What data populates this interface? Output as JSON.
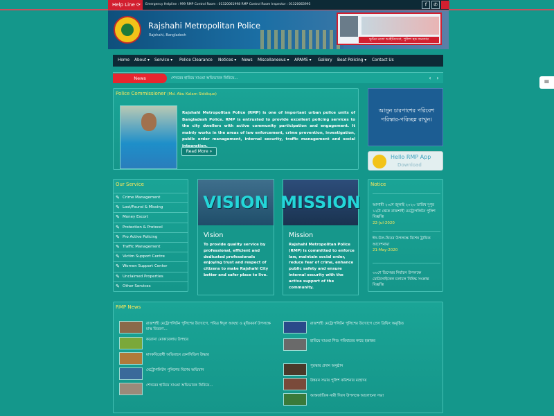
{
  "topbar": {
    "helpline": "Help Line",
    "emergency": "Emergency Helpline : 999     RMP Control Room : 01320061998     RMP Control Room Inspector : 01320063995",
    "social": [
      "f",
      "✆"
    ]
  },
  "header": {
    "title": "Rajshahi Metropolitan Police",
    "subtitle": "Rajshahi, Bangladesh",
    "banner_text": "ভূমির মতো আইনিসেবা, পুলিশ হক জনতার"
  },
  "nav": {
    "items": [
      "Home",
      "About ▾",
      "Service ▾",
      "Police Clearance",
      "Notices ▾",
      "News",
      "Miscellaneous ▾",
      "APAMS ▾",
      "Gallery",
      "Beat Policing ▾",
      "Contact Us"
    ]
  },
  "ticker": {
    "label": "News",
    "text": "শেখরের হারিয়ে যাওয়া অভিভাবক ফিরিয়ে...",
    "prev": "‹",
    "next": "›"
  },
  "commissioner": {
    "heading": "Police Commissioner",
    "name": "(Md. Abu Kalam Siddique)",
    "description": "Rajshahi Metropolitan Police (RMP) is one of important urban police units of Bangladesh Police. RMP is entrusted to provide excellent policing services to the city dwellers with active community participation and engagement. It mainly works in the areas of law enforcement, crime prevention, investigation, public order management, internal security, traffic management and social integration.",
    "read_more": "Read More »"
  },
  "clean_banner": {
    "text": "আসুন চারপাশের পরিবেশ পরিস্কার-পরিচ্ছন্ন রাখুন।"
  },
  "app_banner": {
    "title": "Hello RMP App",
    "download": "Download"
  },
  "services": {
    "title": "Our Service",
    "items": [
      "Crime Management",
      "Lost/Found & Missing",
      "Money Escort",
      "Protection & Protocol",
      "Pro Active Policing",
      "Traffic Management",
      "Victim Support Centre",
      "Women Support Center",
      "Unclaimed Properties",
      "Other Services"
    ]
  },
  "vision": {
    "image_word": "VISION",
    "title": "Vision",
    "text": "To provide quality service by professional, efficient and dedicated professionals enjoying trust and respect of citizens to make Rajshahi City better and safer place to live."
  },
  "mission": {
    "image_word": "MISSION",
    "title": "Mission",
    "text": "Rajshahi Metropolitan Police (RMP) is committed to enforce law, maintain social order, reduce fear of crime, enhance public safety and ensure internal security with the active support of the community."
  },
  "notice": {
    "title": "Notice",
    "items": [
      {
        "text": "আগামী ২৩শে জুলাই ২০২০ তারিখ দুপুর ১২টা থেকে রাজশাহী মেট্রোপলিটন পুলিশ বিজ্ঞপ্তি",
        "date": "22-Jul-2020"
      },
      {
        "text": "ঈদ-উল-ফিতর উপলক্ষে বিশেষ ট্রাফিক আদেশনামা",
        "date": "21-May-2020"
      },
      {
        "text": "৩০শে ডিসেম্বর নির্বাচন উপলক্ষে মোটরসাইকেল চলাচল নিষিদ্ধ সংক্রান্ত বিজ্ঞপ্তি",
        "date": ""
      }
    ]
  },
  "rmp_news": {
    "title": "RMP News",
    "left": [
      "রাজশাহী মেট্রোপলিটন পুলিশের উদ্যোগে, পবিত্র ঈদুল আযহা ও মুজিববর্ষ উপলক্ষে মাস্ক বিতরণ...",
      "করোনা মোকাবেলায় উপহার",
      "মাদকবিরোধী অভিযানে ফেনসিডিল উদ্ধার",
      "মেট্রোপলিটন পুলিশের বিশেষ অভিযান",
      "শেখরের হারিয়ে যাওয়া অভিভাবক ফিরিয়ে..."
    ],
    "right": [
      "রাজশাহী মেট্রোপলিটন পুলিশের উদ্যোগে প্রেস ব্রিফিং অনুষ্ঠিত",
      "হারিয়ে যাওয়া শিশু পরিবারের কাছে হস্তান্তর",
      "পুরস্কার প্রদান অনুষ্ঠান",
      "উন্নয়ন সভায় পুলিশ কমিশনার মহোদয়",
      "আন্তর্জাতিক নারী দিবস উপলক্ষে আলোচনা সভা"
    ]
  }
}
